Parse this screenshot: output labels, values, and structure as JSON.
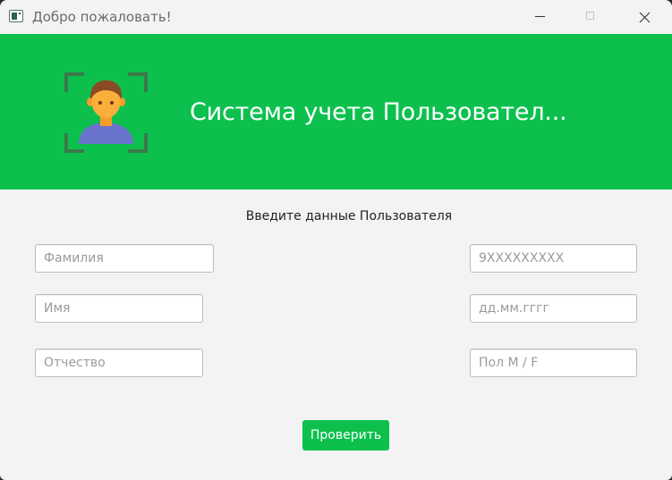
{
  "window": {
    "title": "Добро пожаловать!",
    "controls": [
      "minimize-icon",
      "maximize-icon",
      "close-icon"
    ]
  },
  "header": {
    "title": "Система учета Пользовател...",
    "background": "#0dc04e",
    "logo_icon": "user-scan-icon"
  },
  "form": {
    "caption": "Введите данные Пользователя",
    "fields": {
      "surname": {
        "value": "",
        "placeholder": "Фамилия"
      },
      "name": {
        "value": "",
        "placeholder": "Имя"
      },
      "patronymic": {
        "value": "",
        "placeholder": "Отчество"
      },
      "phone": {
        "value": "",
        "placeholder": "9XXXXXXXXX"
      },
      "birth_date": {
        "value": "",
        "placeholder": "дд.мм.гггг"
      },
      "gender": {
        "value": "",
        "placeholder": "Пол M / F"
      }
    },
    "submit_label": "Проверить",
    "accent": "#0dc04e"
  }
}
